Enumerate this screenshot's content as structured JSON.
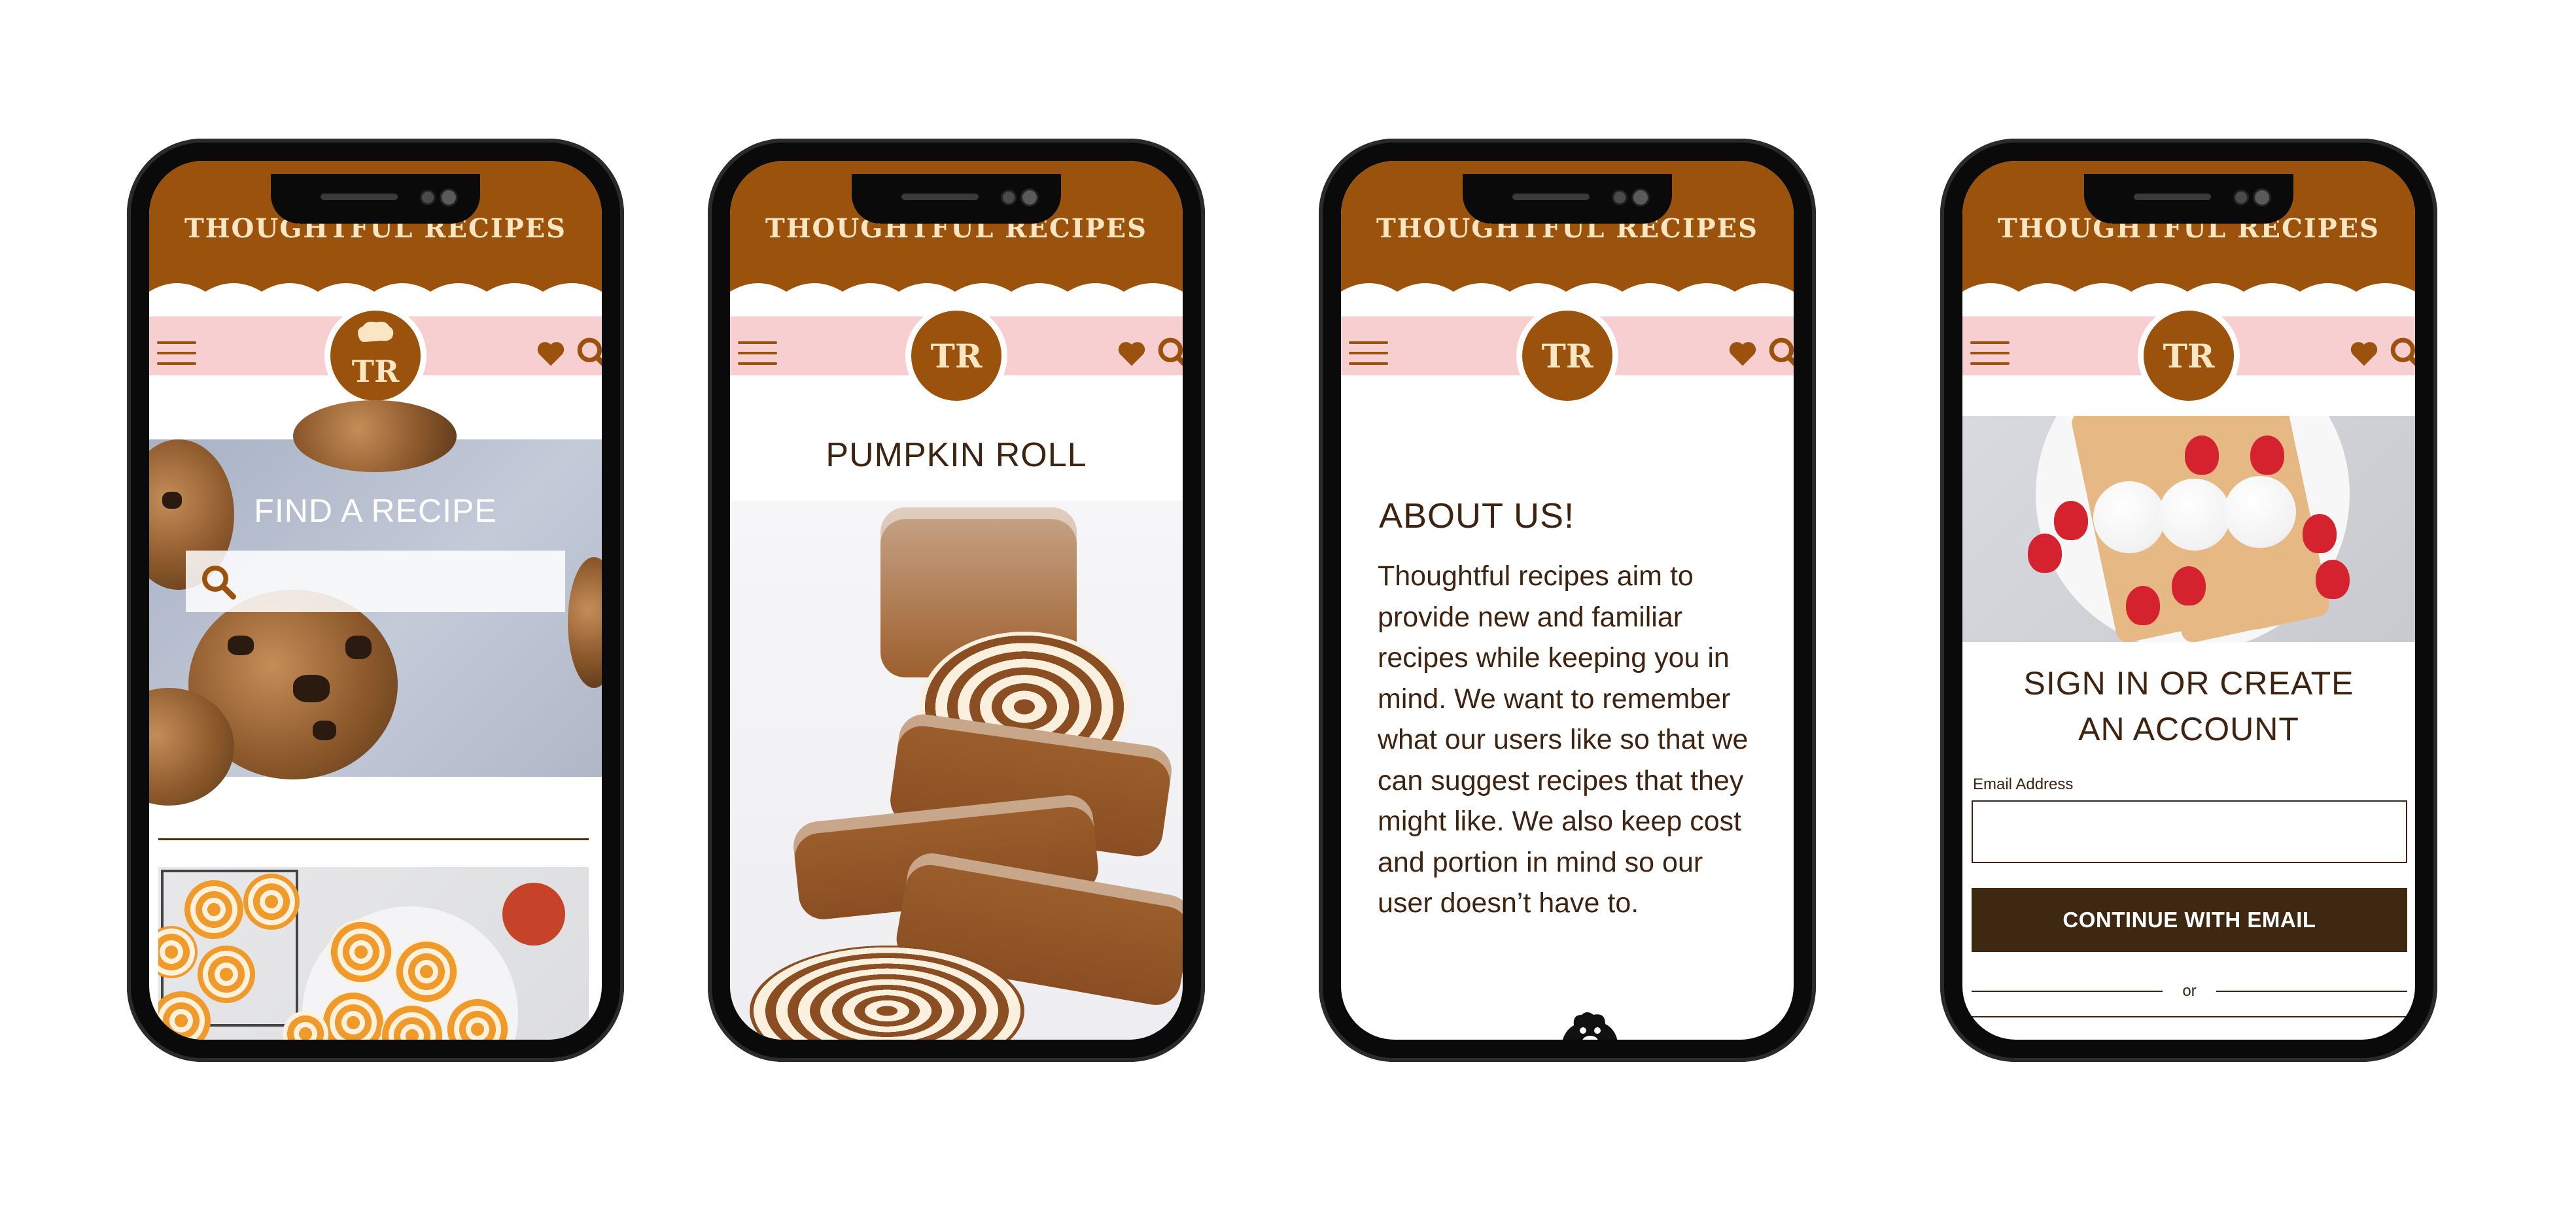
{
  "brand": {
    "name": "THOUGHTFUL RECIPES",
    "logo_initials": "TR"
  },
  "colors": {
    "brown": "#9b520d",
    "cream": "#fbe6c4",
    "pink": "#f8cfd0",
    "dark_brown": "#3e2410"
  },
  "icons": [
    "menu-icon",
    "heart-icon",
    "search-icon",
    "chef-hat-icon"
  ],
  "screens": {
    "find": {
      "title": "FIND A RECIPE",
      "search_placeholder": ""
    },
    "recipe": {
      "title": "PUMPKIN ROLL"
    },
    "about": {
      "title": "ABOUT US!",
      "body": "Thoughtful recipes aim to provide new and familiar recipes while keeping you in mind. We want to remember what our users like so that we can suggest recipes that they might like. We also keep cost and portion in mind so our user doesn’t have to."
    },
    "signin": {
      "title_line1": "SIGN IN OR CREATE",
      "title_line2": "AN ACCOUNT",
      "email_label": "Email Address",
      "email_value": "",
      "continue_label": "CONTINUE WITH EMAIL",
      "or_label": "or"
    }
  }
}
